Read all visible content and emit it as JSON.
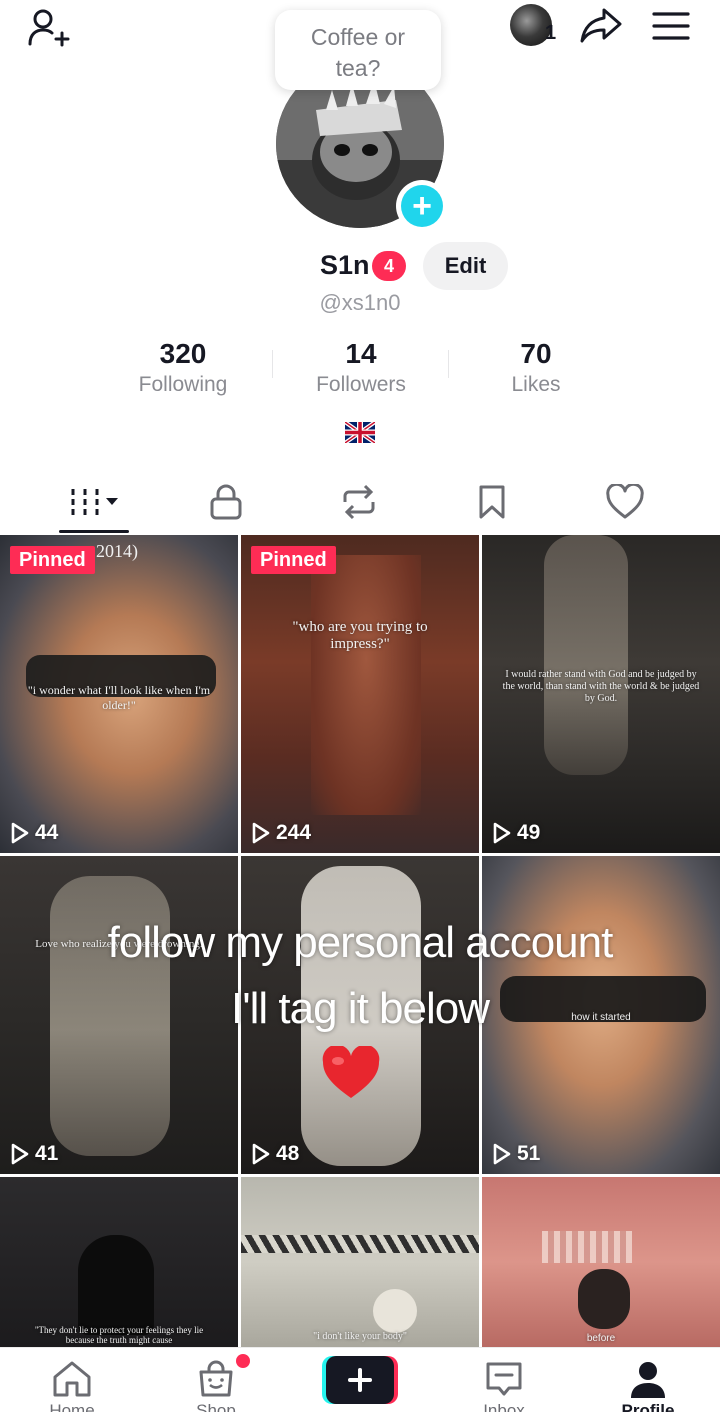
{
  "top_bar": {
    "story_count": "1"
  },
  "bubble": {
    "line1": "Coffee or",
    "line2": "tea?"
  },
  "profile": {
    "username": "S1n",
    "badge": "4",
    "edit_label": "Edit",
    "handle": "@xs1n0"
  },
  "stats": [
    {
      "value": "320",
      "label": "Following"
    },
    {
      "value": "14",
      "label": "Followers"
    },
    {
      "value": "70",
      "label": "Likes"
    }
  ],
  "icons": {
    "add_user": "add-user-icon",
    "share": "share-icon",
    "menu": "hamburger-icon",
    "flag": "uk-flag-icon",
    "tabs": [
      "videos-grid-icon",
      "lock-icon",
      "repost-icon",
      "bookmark-icon",
      "heart-outline-icon"
    ],
    "nav": [
      "home-icon",
      "shop-icon",
      "create-icon",
      "inbox-icon",
      "profile-icon"
    ]
  },
  "colors": {
    "accent": "#fe2c55",
    "cyan": "#20d5ec",
    "text": "#161823",
    "muted": "#8a8b91"
  },
  "grid": {
    "pinned_label": "Pinned",
    "videos": [
      {
        "views": "44",
        "pinned": true,
        "caption": "\"i wonder what I'll look like when I'm older!\"",
        "extra": "2014)"
      },
      {
        "views": "244",
        "pinned": true,
        "caption": "\"who are you trying to impress?\""
      },
      {
        "views": "49",
        "pinned": false,
        "caption": "I would rather stand with God and be judged by the world, than stand with the world & be judged by God."
      },
      {
        "views": "41",
        "pinned": false,
        "caption": "Love who realize you were drowning."
      },
      {
        "views": "48",
        "pinned": false,
        "caption": ""
      },
      {
        "views": "51",
        "pinned": false,
        "caption": "how it started"
      },
      {
        "views": "",
        "pinned": false,
        "caption": "\"They don't lie to protect your feelings they lie because the truth might cause"
      },
      {
        "views": "",
        "pinned": false,
        "caption": "\"i don't like your body\""
      },
      {
        "views": "",
        "pinned": false,
        "caption": "before"
      }
    ]
  },
  "overlay": {
    "line1": "follow my personal account",
    "line2": "I'll tag it below"
  },
  "nav": {
    "items": [
      {
        "label": "Home"
      },
      {
        "label": "Shop"
      },
      {
        "label": ""
      },
      {
        "label": "Inbox"
      },
      {
        "label": "Profile"
      }
    ]
  }
}
